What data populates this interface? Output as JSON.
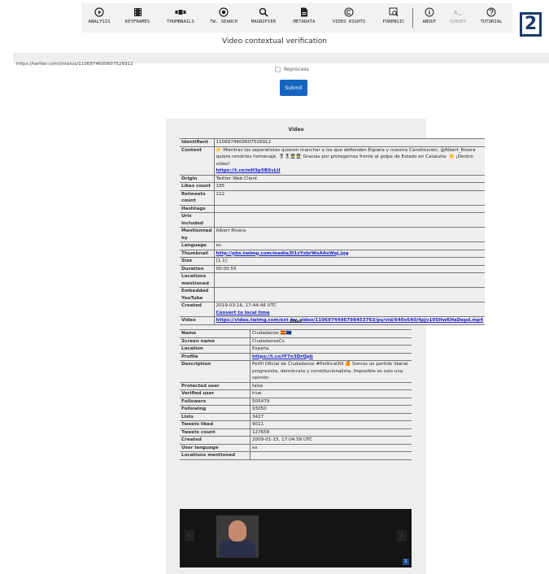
{
  "toolbar": {
    "items": [
      {
        "label": "ANALYSIS",
        "icon": "play-circle-icon"
      },
      {
        "label": "KEYFRAMES",
        "icon": "film-icon"
      },
      {
        "label": "THUMBNAILS",
        "icon": "thumbnails-icon"
      },
      {
        "label": "TW. SEARCH",
        "icon": "twitter-search-icon"
      },
      {
        "label": "MAGNIFIER",
        "icon": "magnifier-icon"
      },
      {
        "label": "METADATA",
        "icon": "file-icon"
      },
      {
        "label": "VIDEO RIGHTS",
        "icon": "copyright-icon"
      },
      {
        "label": "FORENSIC",
        "icon": "forensic-icon"
      },
      {
        "label": "ABOUT",
        "icon": "info-icon"
      },
      {
        "label": "SURVEY",
        "icon": "survey-icon"
      },
      {
        "label": "TUTORIAL",
        "icon": "help-icon"
      }
    ],
    "logo_text": "2"
  },
  "page": {
    "title": "Video contextual verification"
  },
  "url_input": {
    "value": "https://twitter.com/i/status/1106974600607526912"
  },
  "reprocess": {
    "label": "Reprocess"
  },
  "submit": {
    "label": "Submit"
  },
  "video_section": {
    "title": "Video",
    "rows": [
      {
        "key": "Identifiant",
        "value": "1106974600607526912"
      },
      {
        "key": "Content",
        "value": "👉 Mientras los separatistas quieren manchar a los que defienden España y nuestra Constitución, @Albert_Rivera quiere rendirles homenaje. 🎖🎖👮👮 Gracias por protegernos frente al golpe de Estado en Cataluña. 👏 ¡Dentro vídeo! ",
        "link": "https://t.co/mH3p5BSvLU"
      },
      {
        "key": "Origin",
        "value": "Twitter Web Client"
      },
      {
        "key": "Likes count",
        "value": "185"
      },
      {
        "key": "Retweets count",
        "value": "112"
      },
      {
        "key": "Hashtags",
        "value": ""
      },
      {
        "key": "Urls included",
        "value": ""
      },
      {
        "key": "Mentionned by",
        "value": "Albert Rivera"
      },
      {
        "key": "Language",
        "value": "es"
      },
      {
        "key": "Thumbnail",
        "value": "",
        "link": "http://pbs.twimg.com/media/D1zYxbrWsAAxWaj.jpg"
      },
      {
        "key": "Size",
        "value": "[1,1]"
      },
      {
        "key": "Duration",
        "value": "00:00:55"
      },
      {
        "key": "Locations mentioned",
        "value": ""
      },
      {
        "key": "Embedded YouTube",
        "value": ""
      },
      {
        "key": "Created",
        "value": "2019-03-16, 17:44:48 UTC",
        "link": "Convert to local time"
      },
      {
        "key": "Video",
        "value": "",
        "link": "https://video.twimg.com/ext_tw_video/1106974496798453763/pu/vid/640x640/4pjv105HwKHaDepd.mp4"
      }
    ]
  },
  "user_section": {
    "title": "User",
    "rows": [
      {
        "key": "Name",
        "value": "Ciudadanos 🇪🇸🇪🇺"
      },
      {
        "key": "Screen name",
        "value": "CiudadanosCs"
      },
      {
        "key": "Location",
        "value": "España"
      },
      {
        "key": "Profile",
        "value": "",
        "link": "https://t.co/lY7n3DrQpb"
      },
      {
        "key": "Description",
        "value": "Perfil Oficial de Ciudadanos #PolíticaÚtil 🍊 Somos un partido liberal progresista, demócrata y constitucionalista. Imposible es solo una opinión"
      },
      {
        "key": "Protected user",
        "value": "false"
      },
      {
        "key": "Verified user",
        "value": "true"
      },
      {
        "key": "Followers",
        "value": "505479"
      },
      {
        "key": "Following",
        "value": "93050"
      },
      {
        "key": "Lists",
        "value": "3427"
      },
      {
        "key": "Tweets liked",
        "value": "9011"
      },
      {
        "key": "Tweets count",
        "value": "127658"
      },
      {
        "key": "Created",
        "value": "2009-01-15, 17:04:59 UTC"
      },
      {
        "key": "User language",
        "value": "es"
      },
      {
        "key": "Locations mentioned",
        "value": ""
      }
    ]
  },
  "gallery": {
    "counter": "1"
  }
}
